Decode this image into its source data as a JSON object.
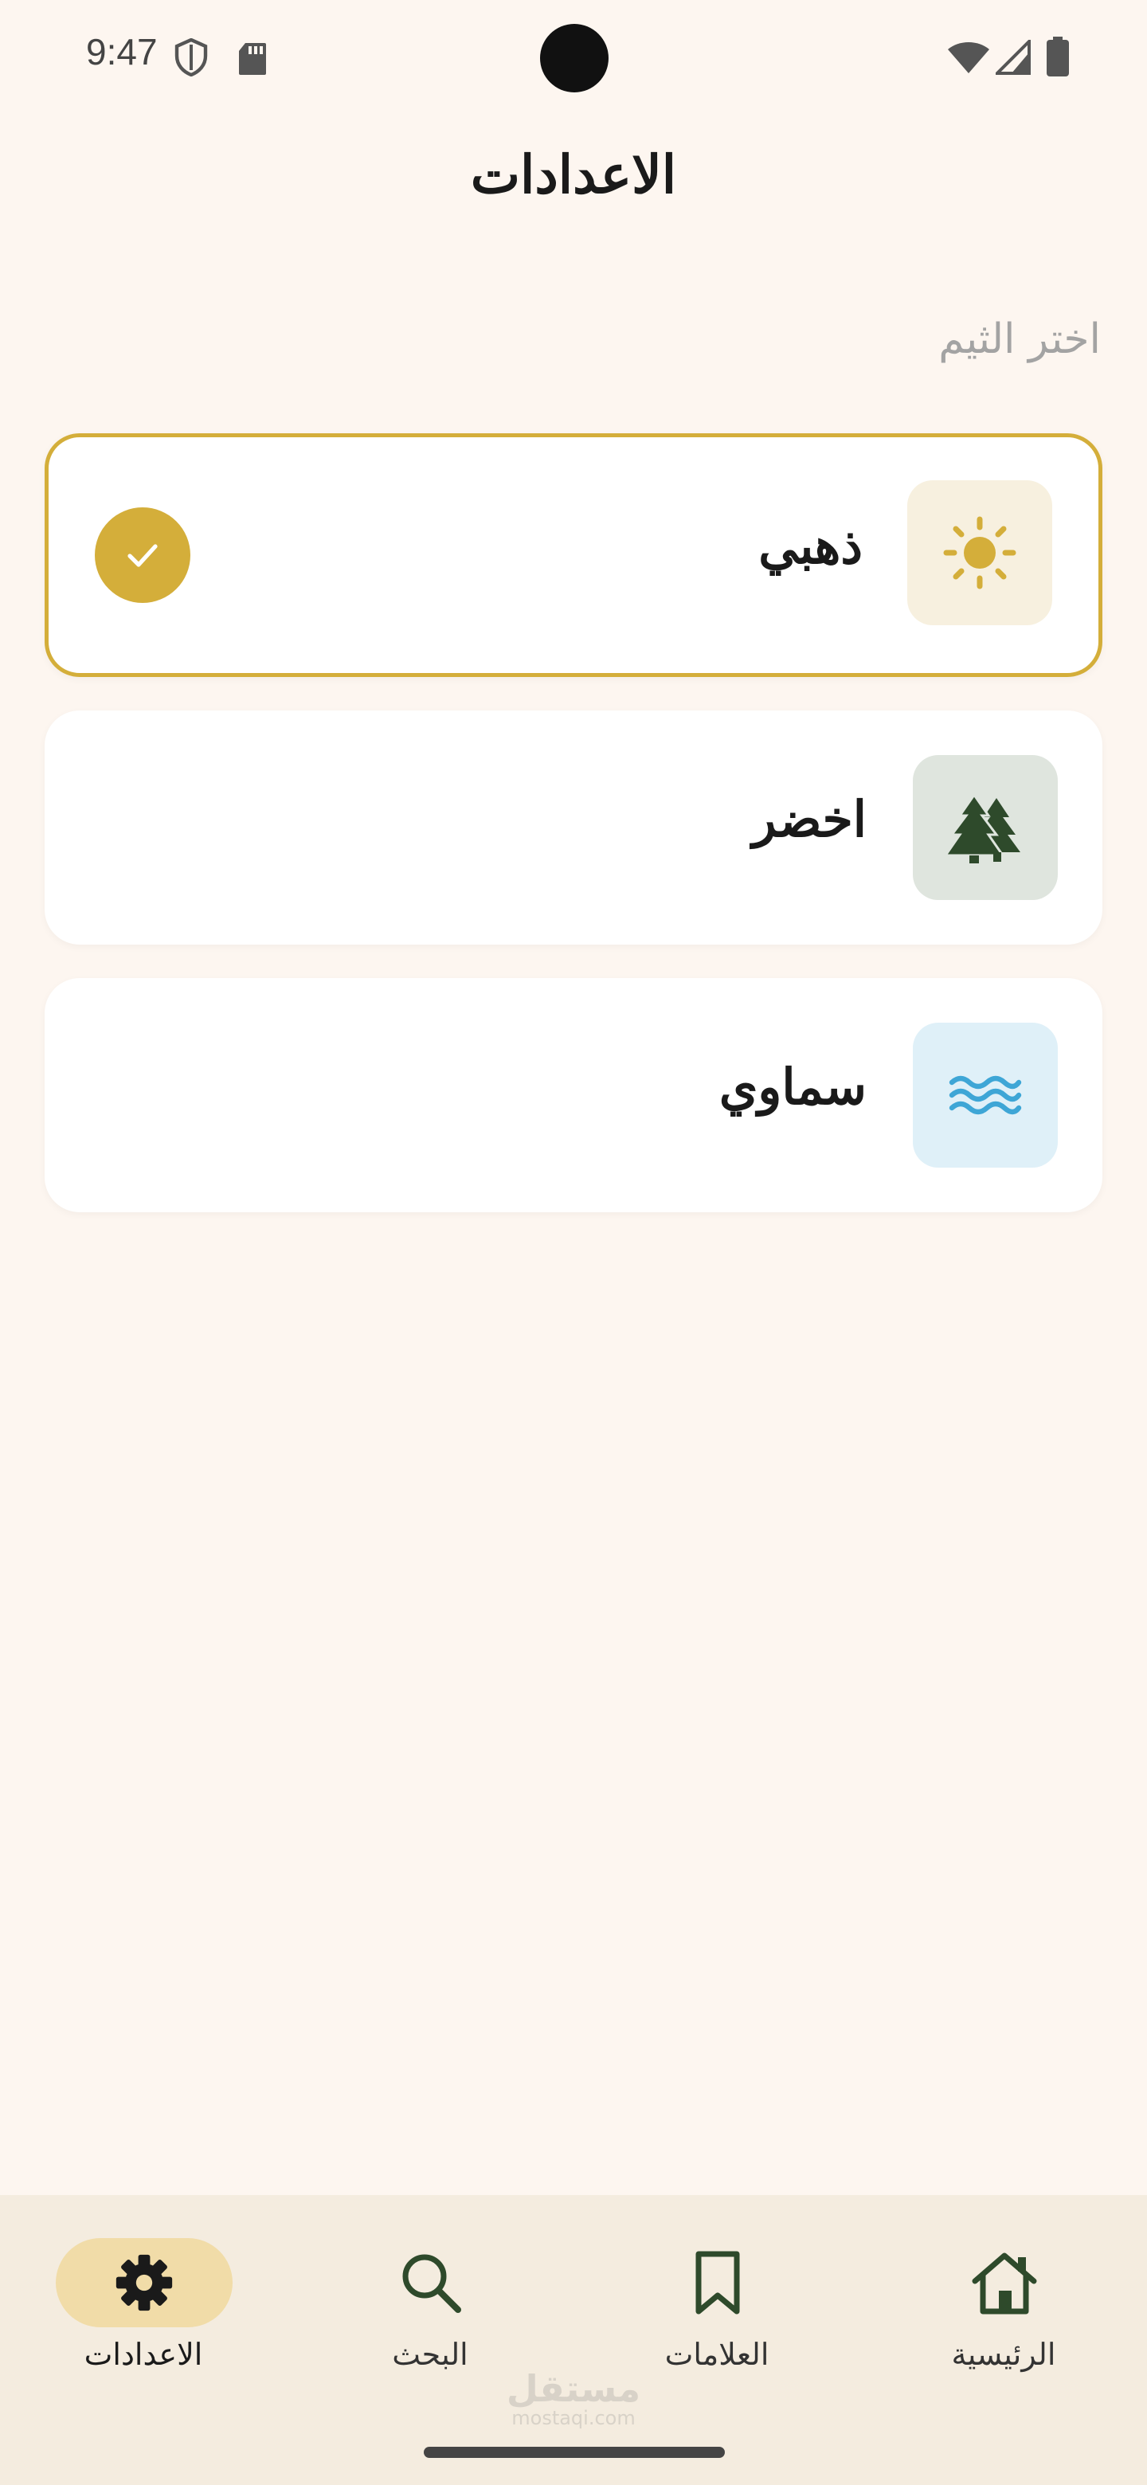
{
  "status_bar": {
    "time": "9:47"
  },
  "header": {
    "title": "الاعدادات"
  },
  "theme_section": {
    "label": "اختر الثيم",
    "themes": [
      {
        "name": "ذهبي",
        "icon": "sun-icon",
        "icon_color": "#d4ae3a",
        "icon_bg": "#f7f0df",
        "selected": true
      },
      {
        "name": "اخضر",
        "icon": "trees-icon",
        "icon_color": "#2e4a2b",
        "icon_bg": "#dfe5de",
        "selected": false
      },
      {
        "name": "سماوي",
        "icon": "waves-icon",
        "icon_color": "#3ea6d6",
        "icon_bg": "#dff0f8",
        "selected": false
      }
    ]
  },
  "bottom_nav": {
    "items": [
      {
        "label": "الرئيسية",
        "icon": "home-icon",
        "active": false
      },
      {
        "label": "العلامات",
        "icon": "bookmark-icon",
        "active": false
      },
      {
        "label": "البحث",
        "icon": "search-icon",
        "active": false
      },
      {
        "label": "الاعدادات",
        "icon": "gear-icon",
        "active": true
      }
    ]
  },
  "watermark": {
    "name": "مستقل",
    "site": "mostaqi.com"
  },
  "colors": {
    "accent": "#d4ae3a",
    "background": "#fdf6f0",
    "nav_background": "#f4ecdf",
    "active_pill": "#f1dca8"
  }
}
